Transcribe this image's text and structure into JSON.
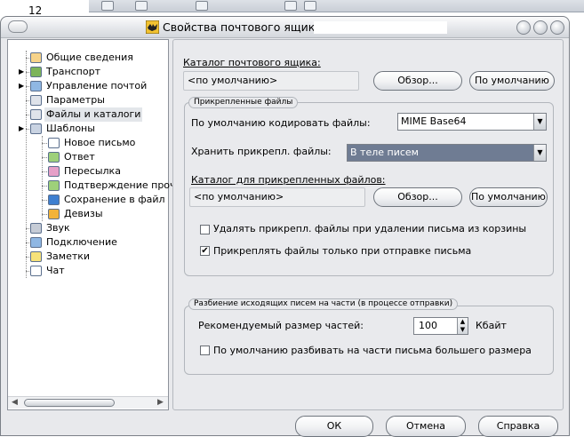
{
  "background": {
    "number": "12"
  },
  "window": {
    "title": "Свойства почтового ящика -"
  },
  "tree": {
    "items": [
      {
        "label": "Общие сведения",
        "icon": "mailbox-info-icon"
      },
      {
        "label": "Транспорт",
        "icon": "transport-icon"
      },
      {
        "label": "Управление почтой",
        "icon": "mail-management-icon"
      },
      {
        "label": "Параметры",
        "icon": "parameters-icon"
      },
      {
        "label": "Файлы и каталоги",
        "icon": "files-folders-icon"
      },
      {
        "label": "Шаблоны",
        "icon": "templates-icon"
      },
      {
        "label": "Новое письмо",
        "icon": "new-letter-icon"
      },
      {
        "label": "Ответ",
        "icon": "reply-icon"
      },
      {
        "label": "Пересылка",
        "icon": "forward-icon"
      },
      {
        "label": "Подтверждение прочт",
        "icon": "read-receipt-icon"
      },
      {
        "label": "Сохранение в файл",
        "icon": "save-to-file-icon"
      },
      {
        "label": "Девизы",
        "icon": "mottos-icon"
      },
      {
        "label": "Звук",
        "icon": "sound-icon"
      },
      {
        "label": "Подключение",
        "icon": "connection-icon"
      },
      {
        "label": "Заметки",
        "icon": "notes-icon"
      },
      {
        "label": "Чат",
        "icon": "chat-icon"
      }
    ],
    "selected": "Файлы и каталоги"
  },
  "content": {
    "mailbox_dir_label": "Каталог почтового ящика:",
    "mailbox_dir_value": "<по умолчанию>",
    "browse_label": "Обзор...",
    "default_label": "По умолчанию",
    "attachments_group_title": "Прикрепленные файлы",
    "encode_label": "По умолчанию кодировать файлы:",
    "encode_value": "MIME Base64",
    "store_label": "Хранить прикрепл. файлы:",
    "store_value": "В теле писем",
    "attach_dir_label": "Каталог для прикрепленных файлов:",
    "attach_dir_value": "<по умолчанию>",
    "delete_attach_label": "Удалять прикрепл. файлы при удалении письма из корзины",
    "delete_attach_checked": false,
    "attach_on_send_label": "Прикреплять файлы только при отправке письма",
    "attach_on_send_checked": true,
    "split_group_title": "Разбиение исходящих писем на части (в процессе отправки)",
    "part_size_label": "Рекомендуемый размер частей:",
    "part_size_value": "100",
    "part_size_unit": "Кбайт",
    "split_default_label": "По умолчанию разбивать на части письма большего размера",
    "split_default_checked": false
  },
  "footer": {
    "ok": "ОК",
    "cancel": "Отмена",
    "help": "Справка"
  },
  "colors": {
    "selected_combo_bg": "#6f7c93",
    "window_bg": "#e8e9ec"
  }
}
